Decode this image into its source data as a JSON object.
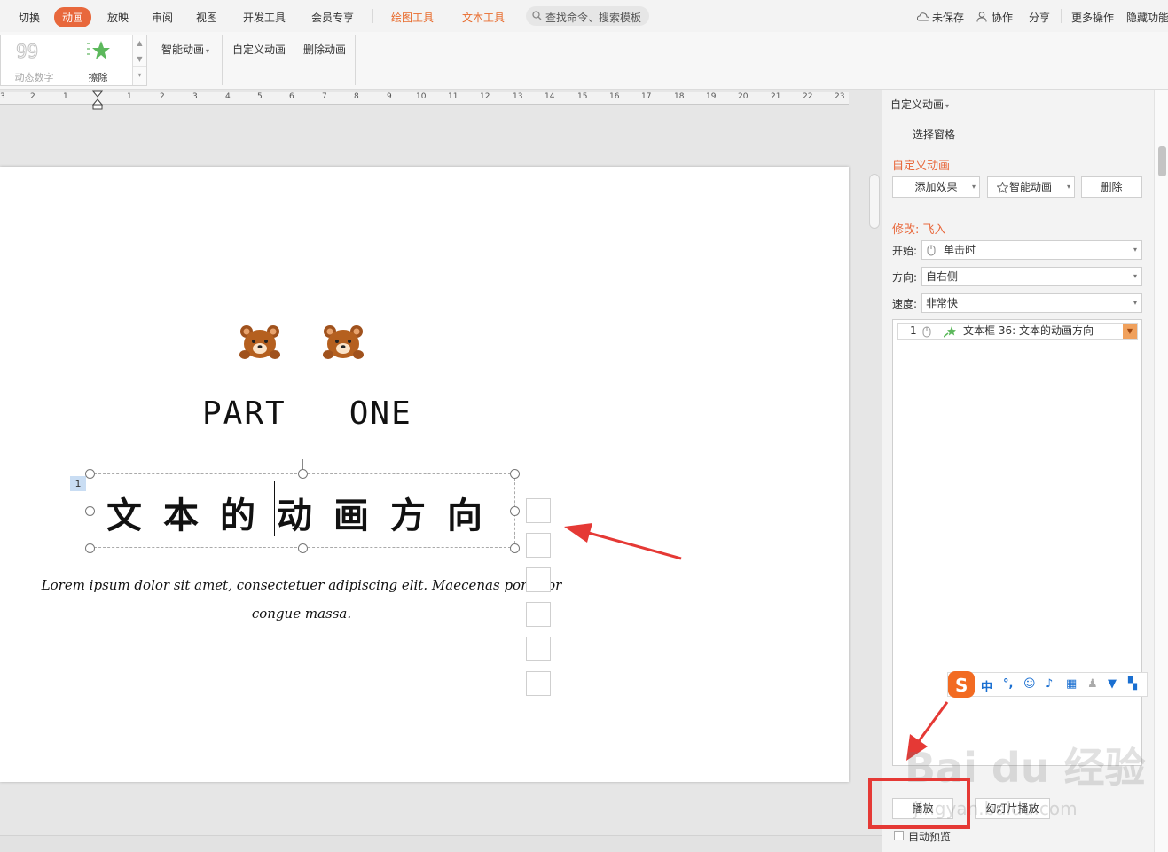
{
  "menu": {
    "tabs": [
      "切换",
      "动画",
      "放映",
      "审阅",
      "视图",
      "开发工具",
      "会员专享",
      "绘图工具",
      "文本工具"
    ],
    "active_tab": "动画",
    "search_placeholder": "查找命令、搜索模板",
    "right": {
      "unsaved": "未保存",
      "collaborate": "协作",
      "share": "分享",
      "more_ops": "更多操作",
      "hide_features": "隐藏功能"
    }
  },
  "ribbon": {
    "gallery": [
      "动态数字",
      "擦除"
    ],
    "smart_animation": "智能动画",
    "custom_animation": "自定义动画",
    "delete_animation": "删除动画"
  },
  "ruler": {
    "left_numbers": [
      "3",
      "2",
      "1"
    ],
    "right_numbers": [
      "1",
      "2",
      "3",
      "4",
      "5",
      "6",
      "7",
      "8",
      "9",
      "10",
      "11",
      "12",
      "13",
      "14",
      "15",
      "16",
      "17",
      "18",
      "19",
      "20",
      "21",
      "22",
      "23"
    ]
  },
  "slide": {
    "part_title": "PART   ONE",
    "title_text": "文本的动画方向",
    "anim_badge": "1",
    "body_text": "Lorem ipsum dolor sit amet, consectetuer adipiscing elit. Maecenas porttitor congue massa."
  },
  "panel": {
    "header": "自定义动画",
    "selection_pane": "选择窗格",
    "section_title": "自定义动画",
    "add_effect": "添加效果",
    "smart_animation": "智能动画",
    "delete": "删除",
    "modify_title": "修改: 飞入",
    "start_label": "开始:",
    "start_value": "单击时",
    "direction_label": "方向:",
    "direction_value": "自右侧",
    "speed_label": "速度:",
    "speed_value": "非常快",
    "list_item": {
      "index": "1",
      "name": "文本框 36: 文本的动画方向"
    },
    "play": "播放",
    "slideshow": "幻灯片播放",
    "auto_preview": "自动预览"
  },
  "ime": {
    "mode": "中",
    "punct": "°,"
  },
  "watermark": {
    "brand": "Bai du 经验",
    "url": "jingyan.baidu.com"
  },
  "colors": {
    "accent": "#e8683c",
    "annotation_red": "#e53935",
    "ime_blue": "#1a6fd1"
  }
}
